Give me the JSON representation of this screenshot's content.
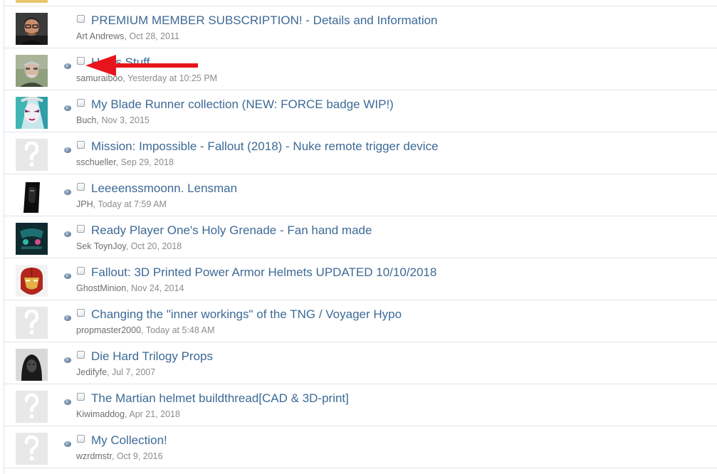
{
  "threads": [
    {
      "title": "",
      "author": "",
      "sep": "",
      "date": "",
      "avatar": "yellow-partial"
    },
    {
      "title": "PREMIUM MEMBER SUBSCRIPTION! - Details and Information",
      "author": "Art Andrews",
      "sep": ", ",
      "date": "Oct 28, 2011",
      "avatar": "man-glasses"
    },
    {
      "title": "Han's Stuff",
      "author": "samuraiboo",
      "sep": ", ",
      "date": "Yesterday at 10:25 PM",
      "avatar": "man-beard"
    },
    {
      "title": "My Blade Runner collection (NEW: FORCE badge WIP!)",
      "author": "Buch",
      "sep": ", ",
      "date": "Nov 3, 2015",
      "avatar": "anime-face"
    },
    {
      "title": "Mission: Impossible - Fallout (2018) - Nuke remote trigger device",
      "author": "sschueller",
      "sep": ", ",
      "date": "Sep 29, 2018",
      "avatar": "default"
    },
    {
      "title": "Leeeenssmoonn. Lensman",
      "author": "JPH",
      "sep": ", ",
      "date": "Today at 7:59 AM",
      "avatar": "dark-figure"
    },
    {
      "title": "Ready Player One's Holy Grenade - Fan hand made",
      "author": "Sek ToynJoy",
      "sep": ", ",
      "date": "Oct 20, 2018",
      "avatar": "teal-logo"
    },
    {
      "title": "Fallout: 3D Printed Power Armor Helmets UPDATED 10/10/2018",
      "author": "GhostMinion",
      "sep": ", ",
      "date": "Nov 24, 2014",
      "avatar": "iron-helmet"
    },
    {
      "title": "Changing the \"inner workings\" of the TNG / Voyager Hypo",
      "author": "propmaster2000",
      "sep": ", ",
      "date": "Today at 5:48 AM",
      "avatar": "default"
    },
    {
      "title": "Die Hard Trilogy Props",
      "author": "Jedifyfe",
      "sep": ", ",
      "date": "Jul 7, 2007",
      "avatar": "hooded-figure"
    },
    {
      "title": "The Martian helmet buildthread[CAD & 3D-print]",
      "author": "Kiwimaddog",
      "sep": ", ",
      "date": "Apr 21, 2018",
      "avatar": "default"
    },
    {
      "title": "My Collection!",
      "author": "wzrdmstr",
      "sep": ", ",
      "date": "Oct 9, 2016",
      "avatar": "default"
    }
  ],
  "colors": {
    "link": "#3d6a96",
    "meta": "#8c8c8c",
    "arrow": "#e8141b",
    "divider": "#dfe6ec"
  }
}
